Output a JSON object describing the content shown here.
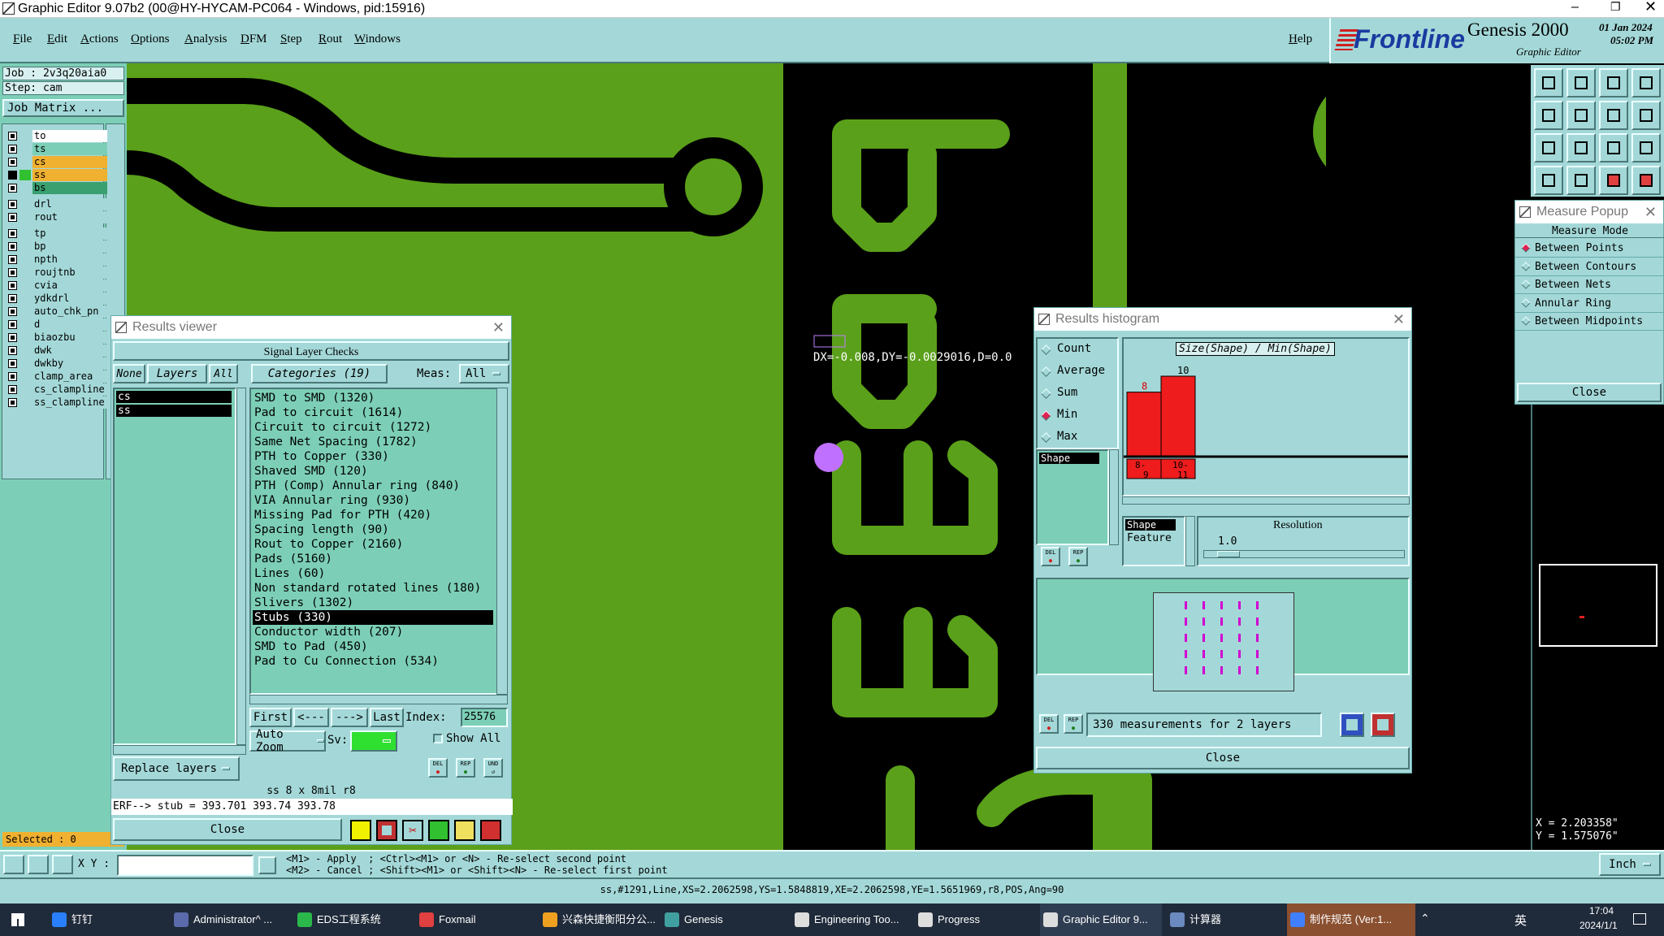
{
  "titlebar": {
    "title": "Graphic Editor 9.07b2 (00@HY-HYCAM-PC064 - Windows, pid:15916)"
  },
  "menu": {
    "items": [
      "File",
      "Edit",
      "Actions",
      "Options",
      "Analysis",
      "DFM",
      "Step",
      "Rout",
      "Windows"
    ],
    "help": "Help"
  },
  "brand": {
    "logo": "Frontline",
    "product": "Genesis 2000",
    "subtitle": "Graphic Editor",
    "date": "01 Jan 2024",
    "time": "05:02 PM"
  },
  "left": {
    "job": "Job : 2v3q20aia0",
    "step": "Step: cam",
    "job_matrix": "Job Matrix ...",
    "layers_group1": [
      {
        "name": "to",
        "color": "#ffffff"
      },
      {
        "name": "ts",
        "color": "#7ccfb6"
      },
      {
        "name": "cs",
        "color": "#f0b030"
      },
      {
        "name": "ss",
        "color": "#f0b030"
      },
      {
        "name": "bs",
        "color": "#3aa070"
      }
    ],
    "layers_group2": [
      {
        "name": "drl",
        "color": "#a4d8d8"
      },
      {
        "name": "rout",
        "color": "#a4d8d8"
      }
    ],
    "layers_group3": [
      "tp",
      "bp",
      "npth",
      "roujtnb",
      "cvia",
      "ydkdrl",
      "auto_chk_pn",
      "d",
      "biaozbu",
      "dwk",
      "dwkby",
      "clamp_area",
      "cs_clampline",
      "ss_clampline"
    ],
    "selected": "Selected : 0"
  },
  "canvas": {
    "measure_text": "DX=-0.008,DY=-0.0029016,D=0.0"
  },
  "results_viewer": {
    "title": "Results viewer",
    "header": "Signal Layer Checks",
    "tabs": {
      "none": "None",
      "layers": "Layers",
      "all": "All",
      "categories": "Categories (19)",
      "meas_label": "Meas:",
      "meas_value": "All"
    },
    "layers": [
      "cs",
      "ss"
    ],
    "categories": [
      "SMD to SMD (1320)",
      "Pad to circuit (1614)",
      "Circuit to circuit (1272)",
      "Same Net Spacing (1782)",
      "PTH to Copper (330)",
      "Shaved SMD (120)",
      "PTH (Comp) Annular ring (840)",
      "VIA Annular ring (930)",
      "Missing Pad for PTH (420)",
      "Spacing length (90)",
      "Rout to Copper (2160)",
      "Pads (5160)",
      "Lines (60)",
      "Non standard rotated lines (180)",
      "Slivers (1302)",
      "Stubs (330)",
      "Conductor width (207)",
      "SMD to Pad (450)",
      "Pad to Cu Connection (534)"
    ],
    "selected_category": "Stubs (330)",
    "nav": {
      "first": "First",
      "prev": "<---",
      "next": "--->",
      "last": "Last",
      "index_label": "Index:",
      "index_value": "25576"
    },
    "auto_zoom": "Auto Zoom",
    "sv_label": "Sv:",
    "show_all": "Show All",
    "replace_layers": "Replace layers",
    "info1": "ss 8 x 8mil  r8",
    "info2": "ERF--> stub = 393.701 393.74 393.78",
    "close": "Close",
    "icon_labels": [
      "DEL",
      "REP",
      "UND"
    ]
  },
  "histogram": {
    "title": "Results histogram",
    "modes": [
      "Count",
      "Average",
      "Sum",
      "Min",
      "Max"
    ],
    "selected_mode": "Min",
    "chart_title": "Size(Shape) / Min(Shape)",
    "list_item": "Shape",
    "res_items": [
      "Shape",
      "Feature"
    ],
    "resolution_label": "Resolution",
    "resolution_value": "1.0",
    "measurements": "330 measurements for 2 layers",
    "close": "Close",
    "icon_labels": [
      "DEL",
      "REP"
    ]
  },
  "chart_data": {
    "type": "bar",
    "title": "Size(Shape) / Min(Shape)",
    "categories": [
      "8-9",
      "10-11"
    ],
    "values": [
      8,
      10
    ],
    "xlabel": "",
    "ylabel": ""
  },
  "measure_popup": {
    "title": "Measure Popup",
    "header": "Measure Mode",
    "options": [
      "Between Points",
      "Between Contours",
      "Between Nets",
      "Annular Ring",
      "Between Midpoints"
    ],
    "selected": "Between Points",
    "close": "Close"
  },
  "coords": {
    "x": "X = 2.203358\"",
    "y": "Y = 1.575076\""
  },
  "bottom": {
    "xy_label": "X Y :",
    "hint1": "<M1> - Apply  ; <Ctrl><M1> or <N> - Re-select second point",
    "hint2": "<M2> - Cancel ; <Shift><M1> or <Shift><N> - Re-select first point",
    "units": "Inch",
    "status": "ss,#1291,Line,XS=2.2062598,YS=1.5848819,XE=2.2062598,YE=1.5651969,r8,POS,Ang=90"
  },
  "taskbar": {
    "items": [
      {
        "label": "钉钉",
        "color": "#2a7fff"
      },
      {
        "label": "Administrator^ ...",
        "color": "#5a6aaa"
      },
      {
        "label": "EDS工程系统",
        "color": "#2ab84a"
      },
      {
        "label": "Foxmail",
        "color": "#e04040"
      },
      {
        "label": "兴森快捷衡阳分公...",
        "color": "#f0a020"
      },
      {
        "label": "Genesis",
        "color": "#40a0a0"
      },
      {
        "label": "Engineering Too...",
        "color": "#ddd"
      },
      {
        "label": "Progress",
        "color": "#ddd"
      },
      {
        "label": "Graphic Editor 9...",
        "color": "#ddd"
      },
      {
        "label": "计算器",
        "color": "#6a8ac0"
      },
      {
        "label": "制作规范 (Ver:1...",
        "color": "#4080ff"
      }
    ],
    "tray_lang": "英",
    "time": "17:04",
    "date": "2024/1/1"
  }
}
